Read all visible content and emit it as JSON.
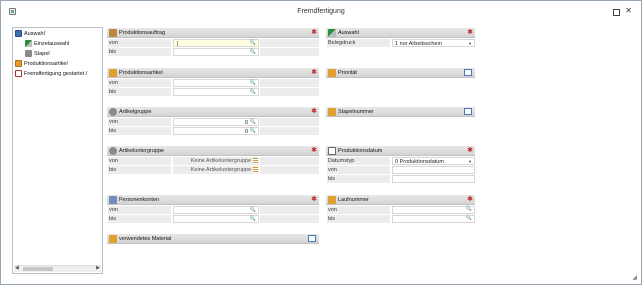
{
  "window": {
    "title": "Fremdfertigung"
  },
  "tree": {
    "items": [
      {
        "label": "Auswahl"
      },
      {
        "label": "Einzelauswahl"
      },
      {
        "label": "Stapel"
      },
      {
        "label": "Produktionsartikel"
      },
      {
        "label": "Fremdfertigung gestartet /"
      }
    ]
  },
  "panels": {
    "produktionsauftrag": {
      "title": "Produktionsauftrag",
      "rows": [
        {
          "label": "von",
          "value": "|"
        },
        {
          "label": "bis",
          "value": ""
        }
      ]
    },
    "produktionsartikel": {
      "title": "Produktionsartikel",
      "rows": [
        {
          "label": "von",
          "value": ""
        },
        {
          "label": "bis",
          "value": ""
        }
      ]
    },
    "artikelgruppe": {
      "title": "Artikelgruppe",
      "rows": [
        {
          "label": "von",
          "value": "0"
        },
        {
          "label": "bis",
          "value": "0"
        }
      ]
    },
    "artikeluntergruppe": {
      "title": "Artikeluntergruppe",
      "rows": [
        {
          "label": "von",
          "value": "Keine Artikeluntergruppe"
        },
        {
          "label": "bis",
          "value": "Keine Artikeluntergruppe"
        }
      ]
    },
    "personenkonten": {
      "title": "Personenkonten",
      "rows": [
        {
          "label": "von",
          "value": ""
        },
        {
          "label": "bis",
          "value": ""
        }
      ]
    },
    "material": {
      "title": "verwendetes Material"
    },
    "auswahl": {
      "title": "Auswahl",
      "rows": [
        {
          "label": "Belegdruck",
          "value": "1 nur Arbeitsschein"
        }
      ]
    },
    "prioritaet": {
      "title": "Priorität"
    },
    "stapelnummer": {
      "title": "Stapelnummer"
    },
    "produktionsdatum": {
      "title": "Produktionsdatum",
      "rows": [
        {
          "label": "Datumstyp",
          "value": "0 Produktionsdatum"
        },
        {
          "label": "von",
          "value": ""
        },
        {
          "label": "bis",
          "value": ""
        }
      ]
    },
    "laufnummer": {
      "title": "Laufnummer",
      "rows": [
        {
          "label": "von",
          "value": ""
        },
        {
          "label": "bis",
          "value": ""
        }
      ]
    }
  },
  "colors": {
    "pin": "#c0282a",
    "focus_field": "#ffffe1",
    "header": "#dcdcdc"
  }
}
